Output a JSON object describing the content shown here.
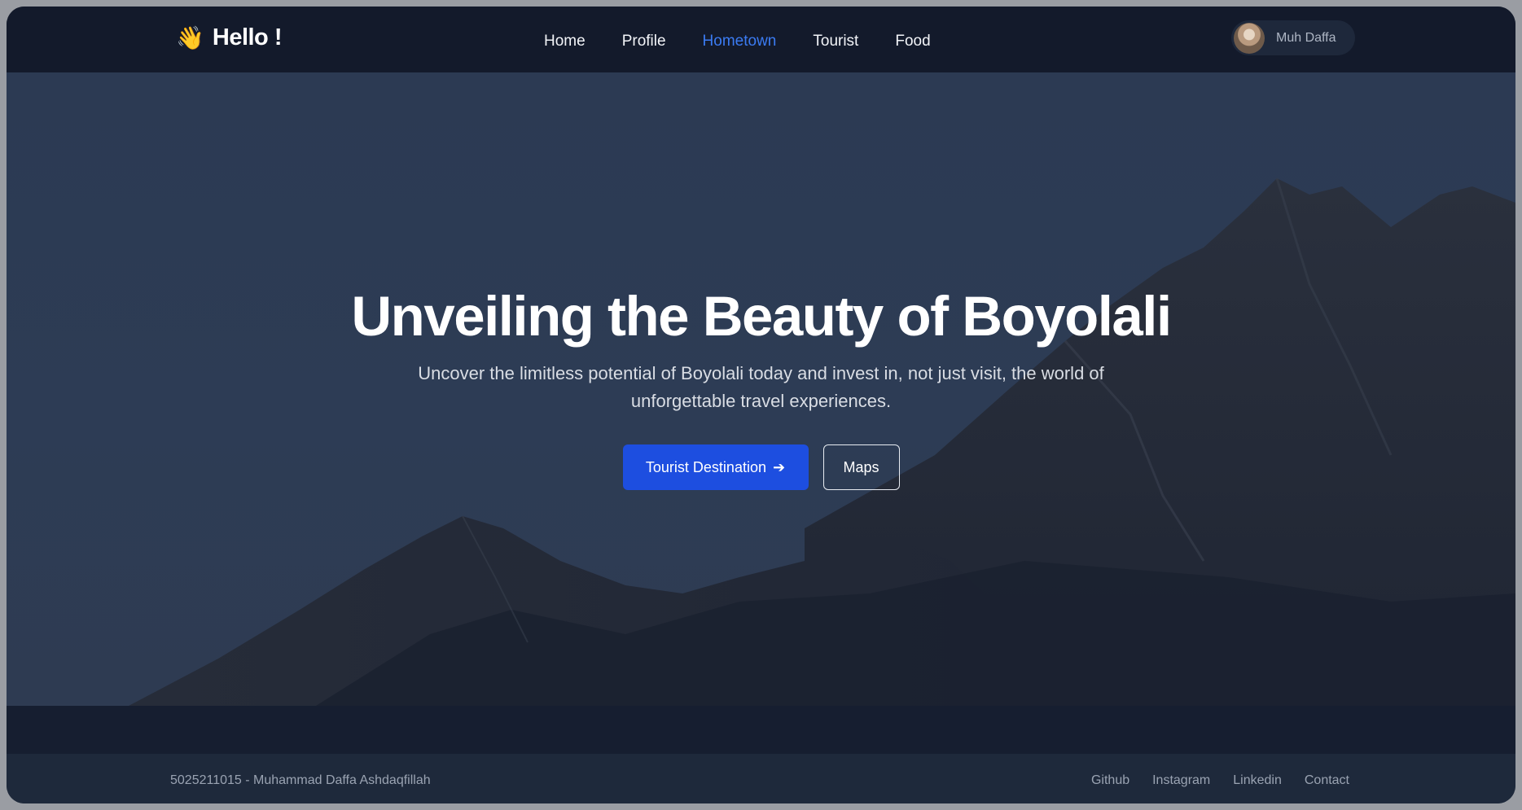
{
  "brand": {
    "icon": "waving-hand-icon",
    "glyph": "👋",
    "title": "Hello !"
  },
  "nav": {
    "items": [
      {
        "label": "Home",
        "active": false
      },
      {
        "label": "Profile",
        "active": false
      },
      {
        "label": "Hometown",
        "active": true
      },
      {
        "label": "Tourist",
        "active": false
      },
      {
        "label": "Food",
        "active": false
      }
    ],
    "active_color": "#3b7bf2"
  },
  "user": {
    "name": "Muh Daffa"
  },
  "hero": {
    "title": "Unveiling the Beauty of Boyolali",
    "subtitle": "Uncover the limitless potential of Boyolali today and invest in, not just visit, the world of unforgettable travel experiences.",
    "primary_button": "Tourist Destination",
    "primary_icon": "arrow-right-icon",
    "arrow_glyph": "➔",
    "secondary_button": "Maps",
    "primary_color": "#1d4ee0"
  },
  "footer": {
    "credit": "5025211015 - Muhammad Daffa Ashdaqfillah",
    "links": [
      "Github",
      "Instagram",
      "Linkedin",
      "Contact"
    ]
  }
}
